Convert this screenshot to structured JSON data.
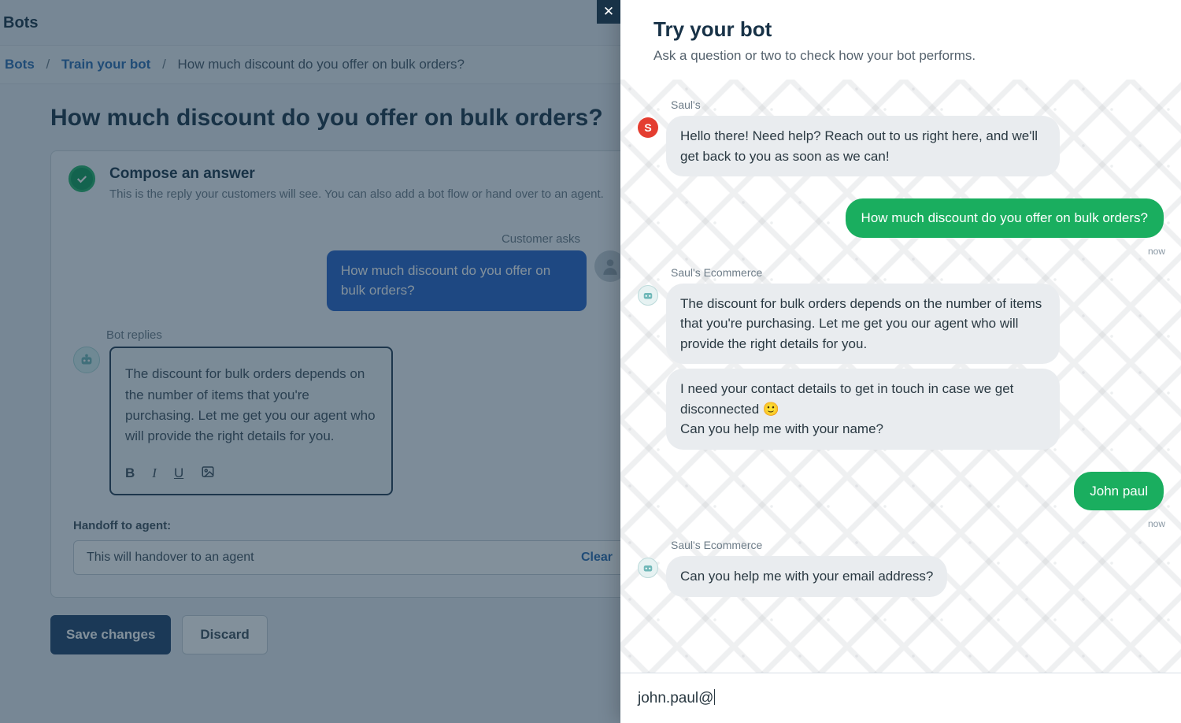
{
  "topbar": {
    "title": "Bots"
  },
  "breadcrumbs": {
    "root": "Bots",
    "parent": "Train your bot",
    "current": "How much discount do you offer on bulk orders?"
  },
  "page": {
    "title": "How much discount do you offer on bulk orders?"
  },
  "compose": {
    "heading": "Compose an answer",
    "sub": "This is the reply your customers will see. You can also add a bot flow or hand over to an agent.",
    "customer_label": "Customer asks",
    "customer_question": "How much discount do you offer on bulk orders?",
    "bot_label": "Bot replies",
    "bot_reply": "The discount for bulk orders depends on the number of items that you're purchasing. Let me get you our agent who will provide the right details for you."
  },
  "handoff": {
    "label": "Handoff to agent:",
    "value": "This will handover to an agent",
    "clear": "Clear"
  },
  "actions": {
    "save": "Save changes",
    "discard": "Discard"
  },
  "panel": {
    "title": "Try your bot",
    "subtitle": "Ask a question or two to check how your bot performs.",
    "close": "✕",
    "input_value": "john.paul@",
    "timestamps": {
      "t1": "now",
      "t2": "now"
    },
    "senders": {
      "s1": "Saul's",
      "s2": "Saul's Ecommerce",
      "s3": "Saul's Ecommerce",
      "avatar_letter": "S"
    },
    "messages": {
      "m0": "Hello there! Need help? Reach out to us right here, and we'll get back to you as soon as we can!",
      "m1": "How much discount do you offer on bulk orders?",
      "m2": "The discount for bulk orders depends on the number of items that you're purchasing. Let me get you our agent who will provide the right details for you.",
      "m3": "I need your contact details to get in touch in case we get disconnected 🙂\nCan you help me with your name?",
      "m4": "John paul",
      "m5": "Can you help me with your email address?"
    }
  }
}
